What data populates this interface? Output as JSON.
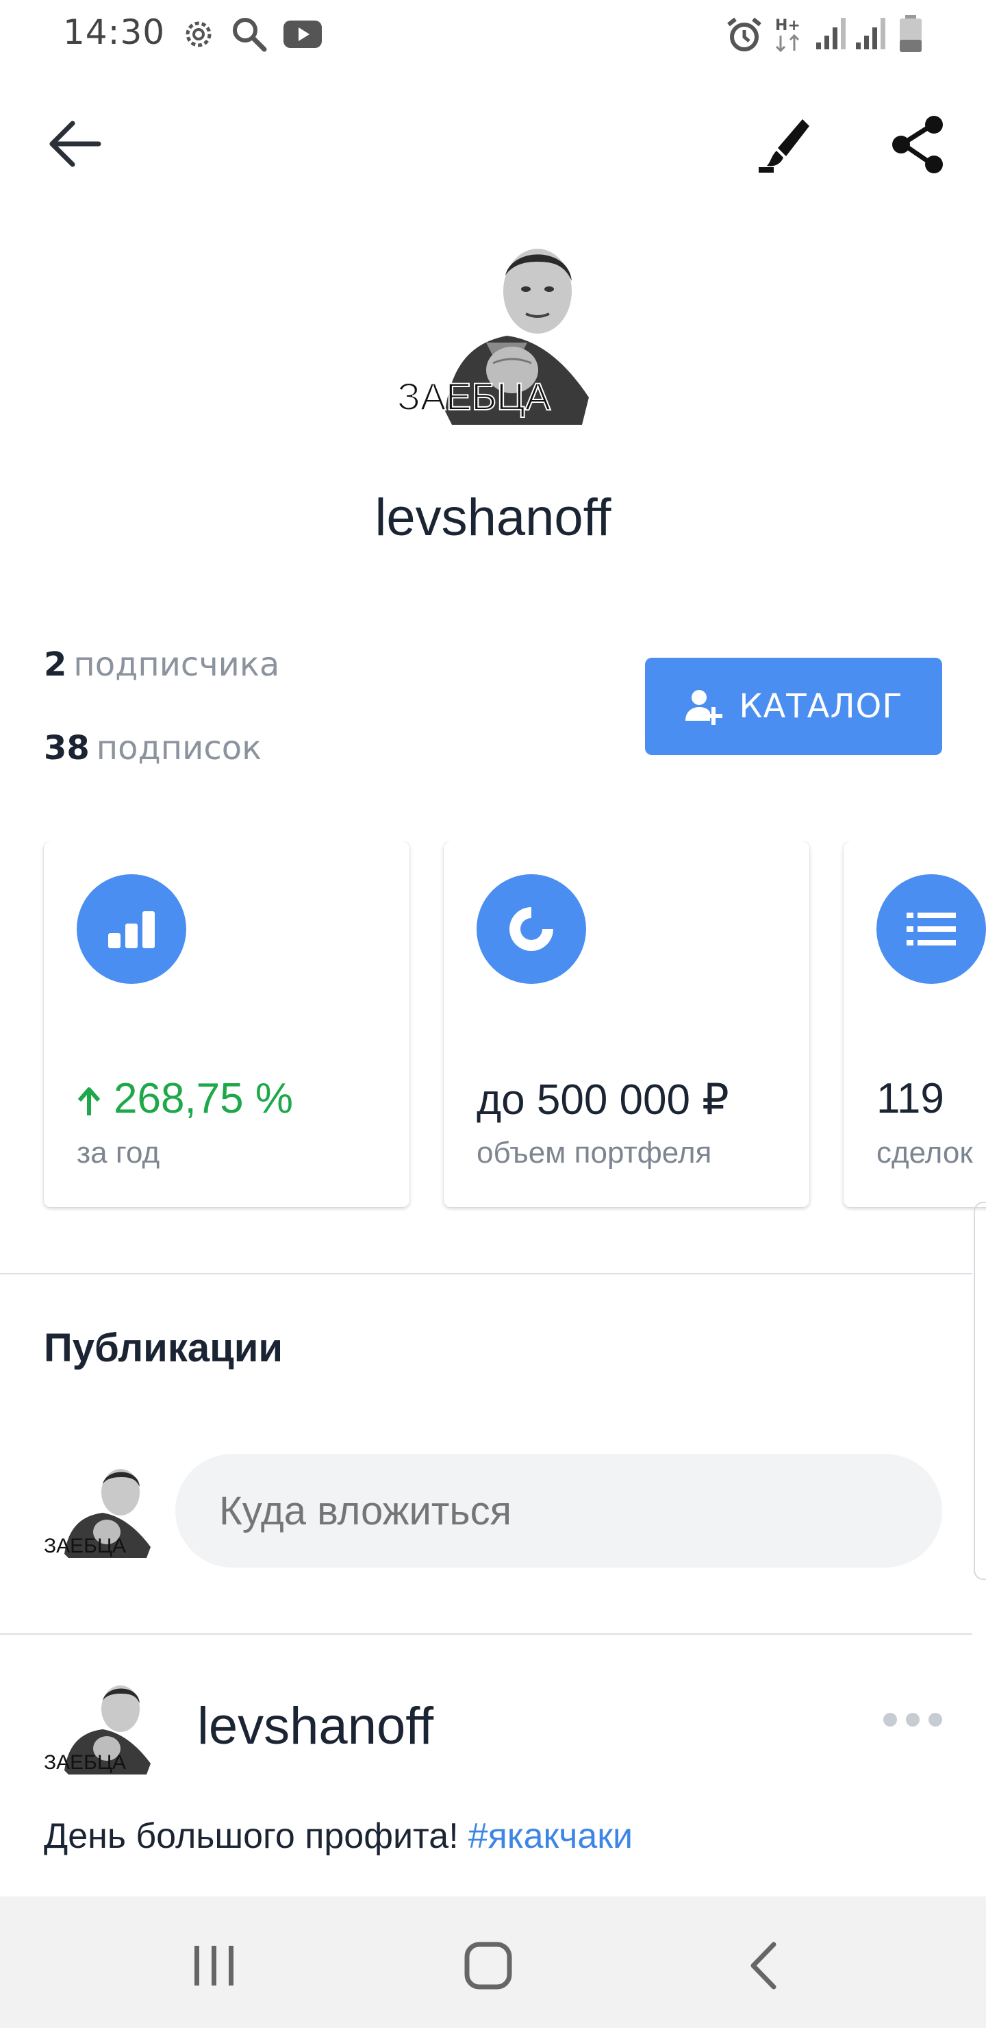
{
  "status_bar": {
    "time": "14:30",
    "icons": [
      "settings-icon",
      "search-icon",
      "youtube-icon",
      "alarm-icon",
      "network-h-plus-icon",
      "signal-icon",
      "signal-icon",
      "battery-icon"
    ],
    "network_label": "H+"
  },
  "app_bar": {
    "back_icon": "arrow-left-icon",
    "edit_icon": "brush-icon",
    "share_icon": "share-icon"
  },
  "profile": {
    "avatar_caption": "ЗАЕБЦА",
    "username": "levshanoff",
    "followers_count": "2",
    "followers_label": "подписчика",
    "following_count": "38",
    "following_label": "подписок",
    "catalog_button": "КАТАЛОГ"
  },
  "cards": [
    {
      "icon": "bar-chart-icon",
      "value": "268,75 %",
      "caption": "за год",
      "trend": "up",
      "color": "#1ea84a"
    },
    {
      "icon": "donut-chart-icon",
      "value": "до 500 000 ₽",
      "caption": "объем портфеля"
    },
    {
      "icon": "list-icon",
      "value": "119",
      "caption": "сделок"
    }
  ],
  "publications": {
    "title": "Публикации",
    "compose_placeholder": "Куда вложиться"
  },
  "post": {
    "author": "levshanoff",
    "text": "День большого профита!",
    "hashtag": "#якакчаки"
  },
  "colors": {
    "accent": "#4a8ef1",
    "positive": "#1ea84a",
    "hashtag": "#3d86e6"
  }
}
